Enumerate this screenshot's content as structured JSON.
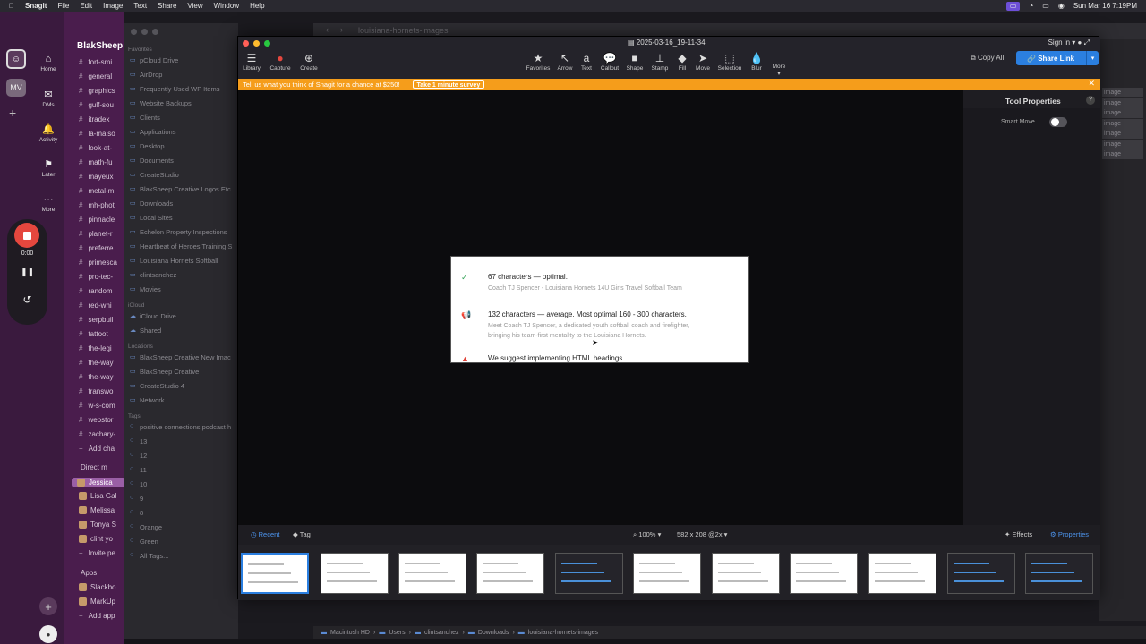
{
  "menubar": {
    "apple": "",
    "app": "Snagit",
    "items": [
      "File",
      "Edit",
      "Image",
      "Text",
      "Share",
      "View",
      "Window",
      "Help"
    ],
    "datetime": "Sun Mar 16  7:19PM"
  },
  "slack": {
    "workspace_initials": "MV",
    "workspace_name": "BlakSheep",
    "rail": [
      {
        "label": "Home",
        "icon": "home-icon",
        "glyph": "⌂"
      },
      {
        "label": "DMs",
        "icon": "dms-icon",
        "glyph": "✉"
      },
      {
        "label": "Activity",
        "icon": "bell-icon",
        "glyph": "🔔"
      },
      {
        "label": "Later",
        "icon": "bookmark-icon",
        "glyph": "⚑"
      },
      {
        "label": "More",
        "icon": "more-icon",
        "glyph": "⋯"
      }
    ],
    "recorder": {
      "time": "0:00"
    },
    "channels": [
      "fort-smi",
      "general",
      "graphics",
      "gulf-sou",
      "itradex",
      "la-maiso",
      "look-at-",
      "math-fu",
      "mayeux",
      "metal-m",
      "mh-phot",
      "pinnacle",
      "planet-r",
      "preferre",
      "primesca",
      "pro-tec-",
      "random",
      "red-whi",
      "serpbuil",
      "tattoot",
      "the-legi",
      "the-way",
      "the-way",
      "transwo",
      "w-s-com",
      "webstor",
      "zachary-"
    ],
    "add_channel": "Add cha",
    "direct_messages": "Direct m",
    "dms": [
      "Jessica",
      "Lisa Gal",
      "Melissa",
      "Tonya S",
      "clint  yo"
    ],
    "invite": "Invite pe",
    "apps_header": "Apps",
    "apps": [
      "Slackbo",
      "MarkUp"
    ],
    "add_apps": "Add app"
  },
  "finder": {
    "favorites_header": "Favorites",
    "favorites": [
      "pCloud Drive",
      "AirDrop",
      "Frequently Used WP Items",
      "Website Backups",
      "Clients",
      "Applications",
      "Desktop",
      "Documents",
      "CreateStudio",
      "BlakSheep Creative Logos Etc",
      "Downloads",
      "Local Sites",
      "Echelon Property Inspections",
      "Heartbeat of Heroes Training S",
      "Louisiana Hornets Softball",
      "clintsanchez",
      "Movies"
    ],
    "icloud_header": "iCloud",
    "icloud": [
      "iCloud Drive",
      "Shared"
    ],
    "locations_header": "Locations",
    "locations": [
      "BlakSheep Creative New Imac",
      "BlakSheep Creative",
      "CreateStudio 4",
      "Network"
    ],
    "tags_header": "Tags",
    "tags": [
      "positive connections podcast h",
      "13",
      "12",
      "11",
      "10",
      "9",
      "8",
      "Orange",
      "Green",
      "All Tags..."
    ],
    "window_title": "louisiana-hornets-images",
    "right_labels": [
      "image",
      "image",
      "image",
      "image",
      "image",
      "image",
      "image"
    ],
    "path": [
      "Macintosh HD",
      "Users",
      "clintsanchez",
      "Downloads",
      "louisiana-hornets-images"
    ]
  },
  "snagit": {
    "title": "2025-03-16_19-11-34",
    "signin": "Sign in",
    "left_tools": [
      {
        "label": "Library",
        "glyph": "☰",
        "icon": "library-icon"
      },
      {
        "label": "Capture",
        "glyph": "●",
        "icon": "capture-icon"
      },
      {
        "label": "Create",
        "glyph": "⊕",
        "icon": "create-icon"
      }
    ],
    "tools": [
      {
        "label": "Favorites",
        "glyph": "★",
        "icon": "star-icon"
      },
      {
        "label": "Arrow",
        "glyph": "↖",
        "icon": "arrow-icon"
      },
      {
        "label": "Text",
        "glyph": "a",
        "icon": "text-icon"
      },
      {
        "label": "Callout",
        "glyph": "💬",
        "icon": "callout-icon"
      },
      {
        "label": "Shape",
        "glyph": "■",
        "icon": "shape-icon"
      },
      {
        "label": "Stamp",
        "glyph": "⊥",
        "icon": "stamp-icon"
      },
      {
        "label": "Fill",
        "glyph": "◆",
        "icon": "fill-icon"
      },
      {
        "label": "Move",
        "glyph": "➤",
        "icon": "move-icon"
      },
      {
        "label": "Selection",
        "glyph": "⬚",
        "icon": "selection-icon"
      },
      {
        "label": "Blur",
        "glyph": "💧",
        "icon": "blur-icon"
      },
      {
        "label": "More",
        "glyph": "",
        "icon": "more-icon"
      }
    ],
    "copy_all": "Copy All",
    "share_link": "Share Link",
    "banner_text": "Tell us what you think of Snagit for a chance at $250!",
    "banner_button": "Take 1 minute survey",
    "tool_properties": "Tool Properties",
    "smart_move": "Smart Move",
    "smart_move_on": false,
    "capture": {
      "rows": [
        {
          "icon": "check-icon",
          "glyph": "✓",
          "color": "#3aa55c",
          "title": "67 characters — optimal.",
          "sub": [
            "Coach TJ Spencer - Louisiana Hornets 14U Girls Travel Softball Team"
          ]
        },
        {
          "icon": "megaphone-icon",
          "glyph": "📢",
          "color": "#4a90d9",
          "title": "132 characters — average. Most optimal 160 - 300 characters.",
          "sub": [
            "Meet Coach TJ Spencer, a dedicated youth softball coach and firefighter,",
            "bringing his team-first mentality to the Louisiana Hornets."
          ]
        },
        {
          "icon": "warning-icon",
          "glyph": "▲",
          "color": "#e0443a",
          "title": "We suggest implementing HTML headings.",
          "sub": []
        }
      ]
    },
    "footer": {
      "recent": "Recent",
      "tag": "Tag",
      "zoom": "100%",
      "dims": "582 x 208 @2x",
      "effects": "Effects",
      "properties": "Properties"
    },
    "thumbs": 11
  }
}
